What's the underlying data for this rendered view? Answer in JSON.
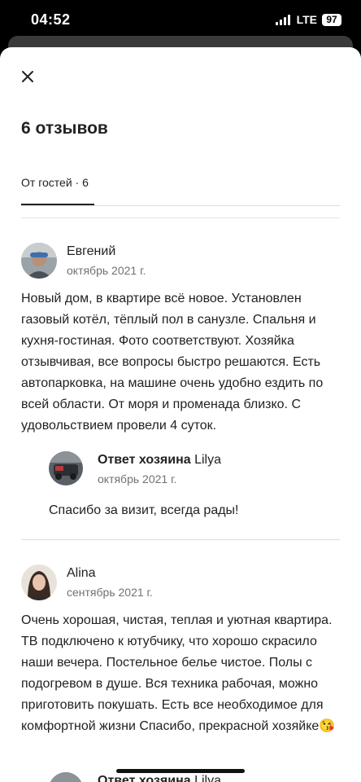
{
  "status": {
    "time": "04:52",
    "network": "LTE",
    "battery": "97"
  },
  "title": "6 отзывов",
  "tabs": [
    {
      "label": "От гостей · 6"
    }
  ],
  "reviews": [
    {
      "author": "Евгений",
      "date": "октябрь 2021 г.",
      "text": "Новый дом, в квартире всё  новое. Установлен газовый котёл, тёплый пол в санузле. Спальня и кухня-гостиная. Фото соответствуют. Хозяйка отзывчивая,  все вопросы быстро решаются. Есть автопарковка, на машине очень удобно ездить по всей области. От моря и променада близко. С удовольствием провели 4 суток.",
      "reply": {
        "label": "Ответ хозяина",
        "host": "Lilya",
        "date": "октябрь 2021 г.",
        "text": "Спасибо за визит, всегда рады!"
      }
    },
    {
      "author": "Alina",
      "date": "сентябрь 2021 г.",
      "text": "Очень хорошая, чистая, теплая и уютная квартира. ТВ подключено к ютубчику, что хорошо скрасило наши вечера. Постельное белье чистое. Полы с подогревом в душе. Вся техника рабочая, можно приготовить покушать. Есть все необходимое для комфортной жизни Спасибо, прекрасной хозяйке😘",
      "reply": {
        "label": "Ответ хозяина",
        "host": "Lilya"
      }
    }
  ],
  "colors": {
    "text": "#222222",
    "secondary": "#717171",
    "divider": "#dddddd"
  }
}
